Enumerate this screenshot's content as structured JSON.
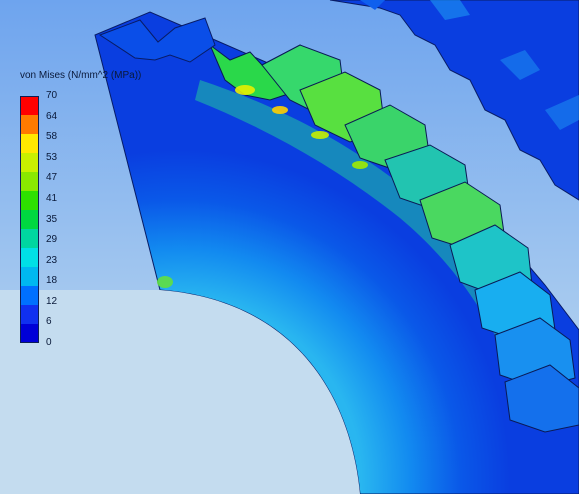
{
  "legend": {
    "title": "von Mises (N/mm^2 (MPa))",
    "ticks": [
      "70",
      "64",
      "58",
      "53",
      "47",
      "41",
      "35",
      "29",
      "23",
      "18",
      "12",
      "6",
      "0"
    ],
    "colors": [
      "#ff0000",
      "#ff7a00",
      "#ffe800",
      "#c9f000",
      "#8ae800",
      "#2ee000",
      "#00d840",
      "#00d6a0",
      "#00e0e6",
      "#00b8f0",
      "#0070ff",
      "#1030f0",
      "#0000d8"
    ]
  },
  "scene": {
    "background_top": "#6ea4ee",
    "background_bottom": "#c8e0f0",
    "gear_base_color": "#0a3ee0",
    "hole_color": "#c4dcef"
  }
}
